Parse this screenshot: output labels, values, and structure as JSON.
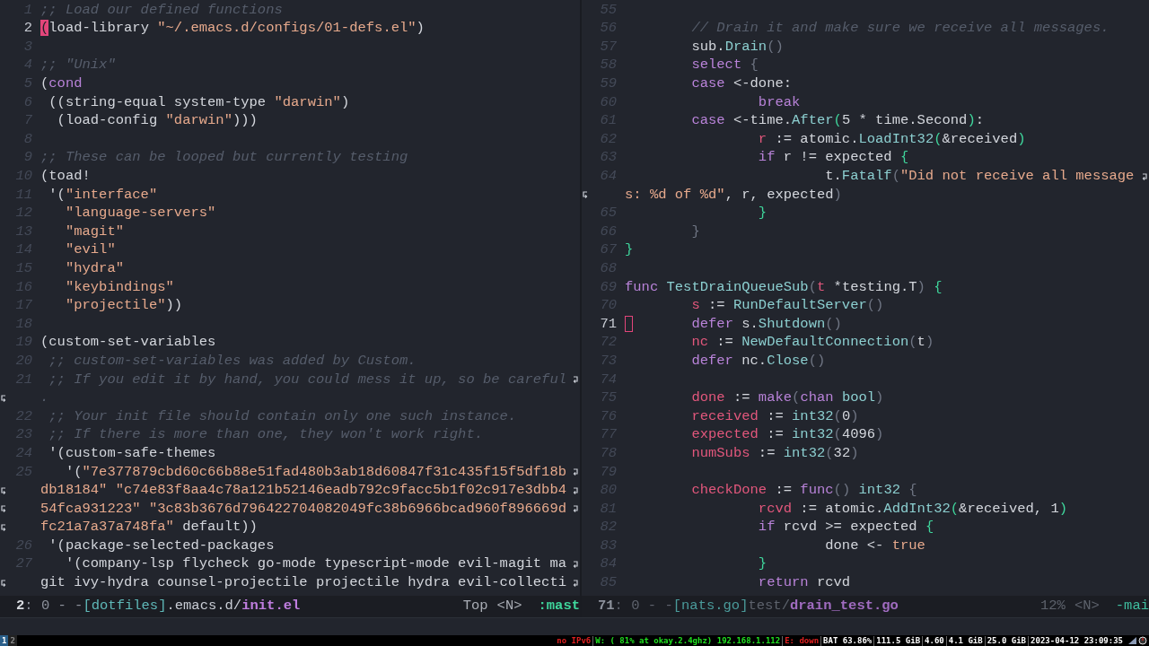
{
  "panes": [
    {
      "active": true,
      "lines": [
        {
          "number": "1",
          "tokens": [
            {
              "text": ";; Load our defined functions",
              "kind": "comment"
            }
          ]
        },
        {
          "number": "2",
          "tokens": [
            {
              "text": "(load-library ",
              "kind": "plain",
              "cursor": true
            },
            {
              "text": "\"~/.emacs.d/configs/01-defs.el\"",
              "kind": "string"
            },
            {
              "text": ")",
              "kind": "plain"
            }
          ]
        },
        {
          "number": "3"
        },
        {
          "number": "4",
          "tokens": [
            {
              "text": ";; \"Unix\"",
              "kind": "comment"
            }
          ]
        },
        {
          "number": "5",
          "tokens": [
            {
              "text": "(",
              "kind": "plain"
            },
            {
              "text": "cond",
              "kind": "keyword"
            }
          ]
        },
        {
          "number": "6",
          "tokens": [
            {
              "text": " ((string-equal system-type ",
              "kind": "plain"
            },
            {
              "text": "\"darwin\"",
              "kind": "string"
            },
            {
              "text": ")",
              "kind": "plain"
            }
          ]
        },
        {
          "number": "7",
          "tokens": [
            {
              "text": "  (load-config ",
              "kind": "plain"
            },
            {
              "text": "\"darwin\"",
              "kind": "string"
            },
            {
              "text": ")))",
              "kind": "plain"
            }
          ]
        },
        {
          "number": "8"
        },
        {
          "number": "9",
          "tokens": [
            {
              "text": ";; These can be looped but currently testing",
              "kind": "comment"
            }
          ]
        },
        {
          "number": "10",
          "tokens": [
            {
              "text": "(toad!",
              "kind": "plain"
            }
          ]
        },
        {
          "number": "11",
          "tokens": [
            {
              "text": " '(",
              "kind": "plain"
            },
            {
              "text": "\"interface\"",
              "kind": "string"
            }
          ]
        },
        {
          "number": "12",
          "tokens": [
            {
              "text": "   \"language-servers\"",
              "kind": "string"
            }
          ]
        },
        {
          "number": "13",
          "tokens": [
            {
              "text": "   \"magit\"",
              "kind": "string"
            }
          ]
        },
        {
          "number": "14",
          "tokens": [
            {
              "text": "   \"evil\"",
              "kind": "string"
            }
          ]
        },
        {
          "number": "15",
          "tokens": [
            {
              "text": "   \"hydra\"",
              "kind": "string"
            }
          ]
        },
        {
          "number": "16",
          "tokens": [
            {
              "text": "   \"keybindings\"",
              "kind": "string"
            }
          ]
        },
        {
          "number": "17",
          "tokens": [
            {
              "text": "   \"projectile\"",
              "kind": "string"
            },
            {
              "text": "))",
              "kind": "plain"
            }
          ]
        },
        {
          "number": "18"
        },
        {
          "number": "19",
          "tokens": [
            {
              "text": "(custom-set-variables",
              "kind": "plain"
            }
          ]
        },
        {
          "number": "20",
          "tokens": [
            {
              "text": " ;; custom-set-variables was added by Custom.",
              "kind": "comment"
            }
          ]
        },
        {
          "number": "21",
          "wraps": true,
          "tokens": [
            {
              "text": " ;; If you edit it by hand, you could mess it up, so be careful",
              "kind": "comment"
            }
          ]
        },
        {
          "tokens": [
            {
              "text": ".",
              "kind": "comment"
            }
          ]
        },
        {
          "number": "22",
          "tokens": [
            {
              "text": " ;; Your init file should contain only one such instance.",
              "kind": "comment"
            }
          ]
        },
        {
          "number": "23",
          "tokens": [
            {
              "text": " ;; If there is more than one, they won't work right.",
              "kind": "comment"
            }
          ]
        },
        {
          "number": "24",
          "tokens": [
            {
              "text": " '(custom-safe-themes",
              "kind": "plain"
            }
          ]
        },
        {
          "number": "25",
          "wraps": true,
          "tokens": [
            {
              "text": "   '(",
              "kind": "plain"
            },
            {
              "text": "\"7e377879cbd60c66b88e51fad480b3ab18d60847f31c435f15f5df18b",
              "kind": "string"
            }
          ]
        },
        {
          "wraps": true,
          "tokens": [
            {
              "text": "db18184\" \"c74e83f8aa4c78a121b52146eadb792c9facc5b1f02c917e3dbb4",
              "kind": "string"
            }
          ]
        },
        {
          "wraps": true,
          "tokens": [
            {
              "text": "54fca931223\" \"3c83b3676d796422704082049fc38b6966bcad960f896669d",
              "kind": "string"
            }
          ]
        },
        {
          "tokens": [
            {
              "text": "fc21a7a37a748fa\"",
              "kind": "string"
            },
            {
              "text": " default))",
              "kind": "plain"
            }
          ]
        },
        {
          "number": "26",
          "tokens": [
            {
              "text": " '(package-selected-packages",
              "kind": "plain"
            }
          ]
        },
        {
          "number": "27",
          "wraps": true,
          "tokens": [
            {
              "text": "   '(company-lsp flycheck go-mode typescript-mode evil-magit ma",
              "kind": "plain"
            }
          ]
        },
        {
          "wraps": true,
          "tokens": [
            {
              "text": "git ivy-hydra counsel-projectile projectile hydra evil-collecti",
              "kind": "plain"
            }
          ]
        }
      ],
      "mode_line": {
        "left": [
          {
            "text": "2",
            "kind": "window"
          },
          {
            "text": ": 0 - -",
            "kind": "info"
          },
          {
            "text": "[dotfiles]",
            "kind": "project"
          },
          {
            "text": ".emacs.d/",
            "kind": "path"
          },
          {
            "text": "init.el",
            "kind": "file"
          }
        ],
        "right": [
          {
            "text": "Top",
            "kind": "position"
          },
          {
            "text": "<N>",
            "kind": "state"
          },
          {
            "text": ":mast",
            "kind": "branch"
          }
        ]
      }
    },
    {
      "active": false,
      "lines": [
        {
          "number": "55"
        },
        {
          "number": "56",
          "tokens": [
            {
              "text": "        // Drain it and make sure we receive all messages.",
              "kind": "comment"
            }
          ]
        },
        {
          "number": "57",
          "tokens": [
            {
              "text": "        sub.",
              "kind": "plain"
            },
            {
              "text": "Drain",
              "kind": "function"
            },
            {
              "text": "()",
              "kind": "paren"
            }
          ]
        },
        {
          "number": "58",
          "tokens": [
            {
              "text": "        select",
              "kind": "keyword"
            },
            {
              "text": " {",
              "kind": "paren"
            }
          ]
        },
        {
          "number": "59",
          "tokens": [
            {
              "text": "        case",
              "kind": "keyword"
            },
            {
              "text": " <-done:",
              "kind": "plain"
            }
          ]
        },
        {
          "number": "60",
          "tokens": [
            {
              "text": "                break",
              "kind": "keyword"
            }
          ]
        },
        {
          "number": "61",
          "tokens": [
            {
              "text": "        case",
              "kind": "keyword"
            },
            {
              "text": " <-time.",
              "kind": "plain"
            },
            {
              "text": "After",
              "kind": "function"
            },
            {
              "text": "(",
              "kind": "brace"
            },
            {
              "text": "5 * time.Second",
              "kind": "plain"
            },
            {
              "text": ")",
              "kind": "brace"
            },
            {
              "text": ":",
              "kind": "plain"
            }
          ]
        },
        {
          "number": "62",
          "tokens": [
            {
              "text": "                r",
              "kind": "variable"
            },
            {
              "text": " := atomic.",
              "kind": "plain"
            },
            {
              "text": "LoadInt32",
              "kind": "function"
            },
            {
              "text": "(",
              "kind": "brace"
            },
            {
              "text": "&received",
              "kind": "plain"
            },
            {
              "text": ")",
              "kind": "brace"
            }
          ]
        },
        {
          "number": "63",
          "tokens": [
            {
              "text": "                if",
              "kind": "keyword"
            },
            {
              "text": " r != expected ",
              "kind": "plain"
            },
            {
              "text": "{",
              "kind": "brace"
            }
          ]
        },
        {
          "number": "64",
          "wraps": true,
          "tokens": [
            {
              "text": "                        t.",
              "kind": "plain"
            },
            {
              "text": "Fatalf",
              "kind": "function"
            },
            {
              "text": "(",
              "kind": "paren"
            },
            {
              "text": "\"Did not receive all message",
              "kind": "string"
            }
          ]
        },
        {
          "tokens": [
            {
              "text": "s: %d of %d\"",
              "kind": "string"
            },
            {
              "text": ", r, expected",
              "kind": "plain"
            },
            {
              "text": ")",
              "kind": "paren"
            }
          ]
        },
        {
          "number": "65",
          "tokens": [
            {
              "text": "                }",
              "kind": "brace"
            }
          ]
        },
        {
          "number": "66",
          "tokens": [
            {
              "text": "        }",
              "kind": "paren"
            }
          ]
        },
        {
          "number": "67",
          "tokens": [
            {
              "text": "}",
              "kind": "brace"
            }
          ]
        },
        {
          "number": "68"
        },
        {
          "number": "69",
          "tokens": [
            {
              "text": "func",
              "kind": "keyword"
            },
            {
              "text": " TestDrainQueueSub",
              "kind": "function"
            },
            {
              "text": "(",
              "kind": "paren"
            },
            {
              "text": "t",
              "kind": "variable"
            },
            {
              "text": " *testing.T",
              "kind": "plain"
            },
            {
              "text": ")",
              "kind": "paren"
            },
            {
              "text": " {",
              "kind": "brace"
            }
          ]
        },
        {
          "number": "70",
          "tokens": [
            {
              "text": "        s",
              "kind": "variable"
            },
            {
              "text": " := ",
              "kind": "plain"
            },
            {
              "text": "RunDefaultServer",
              "kind": "function"
            },
            {
              "text": "()",
              "kind": "paren"
            }
          ]
        },
        {
          "number": "71",
          "tokens": [
            {
              "text": "        defer",
              "kind": "keyword",
              "cursor": true
            },
            {
              "text": " s.",
              "kind": "plain"
            },
            {
              "text": "Shutdown",
              "kind": "function"
            },
            {
              "text": "()",
              "kind": "paren"
            }
          ]
        },
        {
          "number": "72",
          "tokens": [
            {
              "text": "        nc",
              "kind": "variable"
            },
            {
              "text": " := ",
              "kind": "plain"
            },
            {
              "text": "NewDefaultConnection",
              "kind": "function"
            },
            {
              "text": "(",
              "kind": "paren"
            },
            {
              "text": "t",
              "kind": "plain"
            },
            {
              "text": ")",
              "kind": "paren"
            }
          ]
        },
        {
          "number": "73",
          "tokens": [
            {
              "text": "        defer",
              "kind": "keyword"
            },
            {
              "text": " nc.",
              "kind": "plain"
            },
            {
              "text": "Close",
              "kind": "function"
            },
            {
              "text": "()",
              "kind": "paren"
            }
          ]
        },
        {
          "number": "74"
        },
        {
          "number": "75",
          "tokens": [
            {
              "text": "        done",
              "kind": "variable"
            },
            {
              "text": " := ",
              "kind": "plain"
            },
            {
              "text": "make",
              "kind": "keyword"
            },
            {
              "text": "(",
              "kind": "paren"
            },
            {
              "text": "chan",
              "kind": "keyword"
            },
            {
              "text": " bool",
              "kind": "function"
            },
            {
              "text": ")",
              "kind": "paren"
            }
          ]
        },
        {
          "number": "76",
          "tokens": [
            {
              "text": "        received",
              "kind": "variable"
            },
            {
              "text": " := ",
              "kind": "plain"
            },
            {
              "text": "int32",
              "kind": "function"
            },
            {
              "text": "(",
              "kind": "paren"
            },
            {
              "text": "0",
              "kind": "plain"
            },
            {
              "text": ")",
              "kind": "paren"
            }
          ]
        },
        {
          "number": "77",
          "tokens": [
            {
              "text": "        expected",
              "kind": "variable"
            },
            {
              "text": " := ",
              "kind": "plain"
            },
            {
              "text": "int32",
              "kind": "function"
            },
            {
              "text": "(",
              "kind": "paren"
            },
            {
              "text": "4096",
              "kind": "plain"
            },
            {
              "text": ")",
              "kind": "paren"
            }
          ]
        },
        {
          "number": "78",
          "tokens": [
            {
              "text": "        numSubs",
              "kind": "variable"
            },
            {
              "text": " := ",
              "kind": "plain"
            },
            {
              "text": "int32",
              "kind": "function"
            },
            {
              "text": "(",
              "kind": "paren"
            },
            {
              "text": "32",
              "kind": "plain"
            },
            {
              "text": ")",
              "kind": "paren"
            }
          ]
        },
        {
          "number": "79"
        },
        {
          "number": "80",
          "tokens": [
            {
              "text": "        checkDone",
              "kind": "variable"
            },
            {
              "text": " := ",
              "kind": "plain"
            },
            {
              "text": "func",
              "kind": "keyword"
            },
            {
              "text": "()",
              "kind": "paren"
            },
            {
              "text": " int32",
              "kind": "function"
            },
            {
              "text": " {",
              "kind": "paren"
            }
          ]
        },
        {
          "number": "81",
          "tokens": [
            {
              "text": "                rcvd",
              "kind": "variable"
            },
            {
              "text": " := atomic.",
              "kind": "plain"
            },
            {
              "text": "AddInt32",
              "kind": "function"
            },
            {
              "text": "(",
              "kind": "brace"
            },
            {
              "text": "&received, 1",
              "kind": "plain"
            },
            {
              "text": ")",
              "kind": "brace"
            }
          ]
        },
        {
          "number": "82",
          "tokens": [
            {
              "text": "                if",
              "kind": "keyword"
            },
            {
              "text": " rcvd >= expected ",
              "kind": "plain"
            },
            {
              "text": "{",
              "kind": "brace"
            }
          ]
        },
        {
          "number": "83",
          "tokens": [
            {
              "text": "                        done <- ",
              "kind": "plain"
            },
            {
              "text": "true",
              "kind": "constant"
            }
          ]
        },
        {
          "number": "84",
          "tokens": [
            {
              "text": "                }",
              "kind": "brace"
            }
          ]
        },
        {
          "number": "85",
          "tokens": [
            {
              "text": "                return",
              "kind": "keyword"
            },
            {
              "text": " rcvd",
              "kind": "plain"
            }
          ]
        }
      ],
      "mode_line": {
        "left": [
          {
            "text": "71",
            "kind": "window"
          },
          {
            "text": ": 0 - -",
            "kind": "info"
          },
          {
            "text": "[nats.go]",
            "kind": "project"
          },
          {
            "text": "test/",
            "kind": "path"
          },
          {
            "text": "drain_test.go",
            "kind": "file"
          }
        ],
        "right": [
          {
            "text": "12%",
            "kind": "position"
          },
          {
            "text": "<N>",
            "kind": "state"
          },
          {
            "text": "-mai",
            "kind": "branch"
          }
        ]
      }
    }
  ],
  "status_bar": {
    "workspaces": [
      {
        "label": "1",
        "selected": true
      },
      {
        "label": "2",
        "selected": false
      }
    ],
    "segments": [
      {
        "text": "no IPv6",
        "color": "#e02020"
      },
      {
        "text": "W: ( 81% at okay.2.4ghz) 192.168.1.112",
        "color": "#20e020"
      },
      {
        "text": "E: down",
        "color": "#e02020"
      },
      {
        "text": "BAT 63.86%",
        "color": "#ffffff"
      },
      {
        "text": "111.5 GiB",
        "color": "#ffffff"
      },
      {
        "text": "4.60",
        "color": "#ffffff"
      },
      {
        "text": "4.1 GiB",
        "color": "#ffffff"
      },
      {
        "text": "25.0 GiB",
        "color": "#ffffff"
      },
      {
        "text": "2023-04-12 23:09:35",
        "color": "#ffffff"
      }
    ]
  }
}
